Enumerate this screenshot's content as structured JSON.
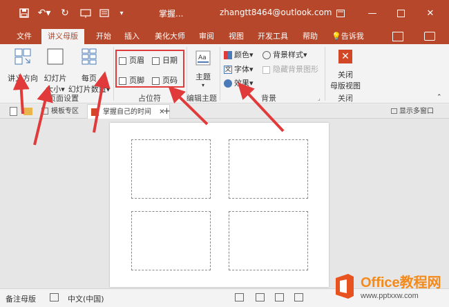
{
  "titlebar": {
    "doc_title": "掌握...",
    "account": "zhangtt8464@outlook.com"
  },
  "tabs": [
    "文件",
    "讲义母版",
    "开始",
    "插入",
    "美化大师",
    "审阅",
    "视图",
    "开发工具",
    "帮助"
  ],
  "tell_me": "告诉我",
  "ribbon": {
    "handout_orientation": "讲义方向",
    "slide_size_line1": "幻灯片",
    "slide_size_line2": "大小",
    "per_page_line1": "每页",
    "per_page_line2": "幻灯片数量",
    "page_setup_group": "页面设置",
    "header": "页眉",
    "date": "日期",
    "footer": "页脚",
    "page_number": "页码",
    "placeholders_group": "占位符",
    "theme": "主题",
    "edit_theme_group": "编辑主题",
    "colors": "颜色",
    "background_styles": "背景样式",
    "fonts": "字体",
    "hide_background": "隐藏背景图形",
    "effects": "效果",
    "background_group": "背景",
    "close_line1": "关闭",
    "close_line2": "母版视图",
    "close_group": "关闭"
  },
  "doc_tabs": {
    "template_zone": "模板专区",
    "current_doc": "掌握自己的时间",
    "show_multi_window": "显示多窗口"
  },
  "status": {
    "view_mode": "备注母版",
    "language": "中文(中国)"
  },
  "watermark": {
    "title": "Office教程网",
    "url": "www.pptxxw.com"
  },
  "colors": {
    "accent": "#b7472a",
    "annotation_red": "#e03a3a"
  }
}
